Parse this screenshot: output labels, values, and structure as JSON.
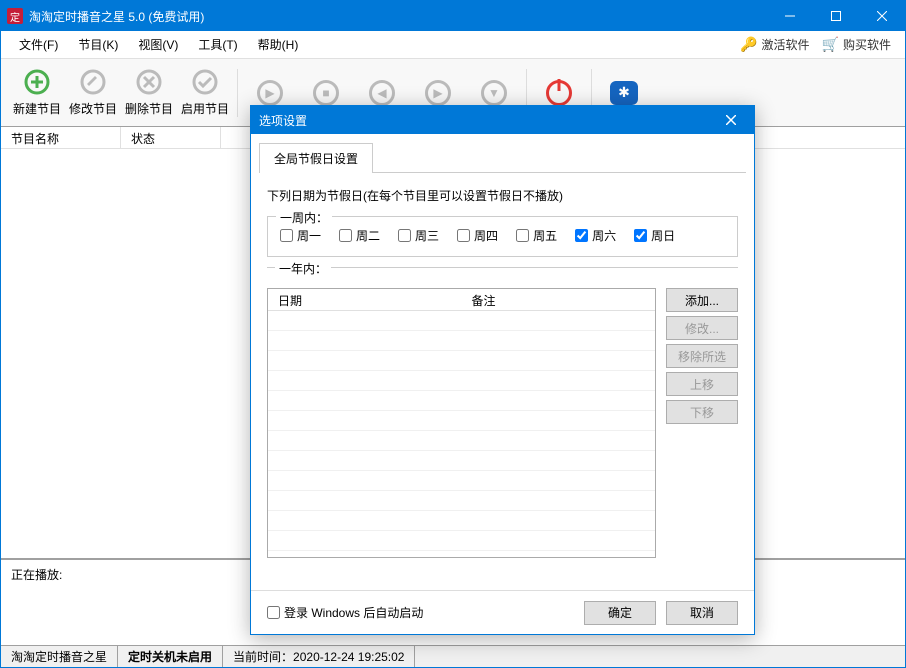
{
  "window": {
    "title": "淘淘定时播音之星 5.0 (免费试用)",
    "app_icon_text": "定"
  },
  "menubar": {
    "items": [
      "文件(F)",
      "节目(K)",
      "视图(V)",
      "工具(T)",
      "帮助(H)"
    ],
    "activate": "激活软件",
    "buy": "购买软件"
  },
  "toolbar": {
    "items": [
      "新建节目",
      "修改节目",
      "删除节目",
      "启用节目"
    ]
  },
  "list": {
    "columns": [
      "节目名称",
      "状态"
    ]
  },
  "bottom": {
    "label": "正在播放:"
  },
  "status": {
    "app": "淘淘定时播音之星",
    "shutdown": "定时关机未启用",
    "time_label": "当前时间：",
    "time_value": "2020-12-24 19:25:02"
  },
  "dialog": {
    "title": "选项设置",
    "tab": "全局节假日设置",
    "desc": "下列日期为节假日(在每个节目里可以设置节假日不播放)",
    "weekly_legend": "一周内：",
    "weekdays": [
      {
        "label": "周一",
        "checked": false
      },
      {
        "label": "周二",
        "checked": false
      },
      {
        "label": "周三",
        "checked": false
      },
      {
        "label": "周四",
        "checked": false
      },
      {
        "label": "周五",
        "checked": false
      },
      {
        "label": "周六",
        "checked": true
      },
      {
        "label": "周日",
        "checked": true
      }
    ],
    "yearly_legend": "一年内：",
    "date_columns": [
      "日期",
      "备注"
    ],
    "buttons": {
      "add": "添加...",
      "edit": "修改...",
      "remove": "移除所选",
      "up": "上移",
      "down": "下移"
    },
    "autostart": "登录 Windows 后自动启动",
    "ok": "确定",
    "cancel": "取消"
  }
}
